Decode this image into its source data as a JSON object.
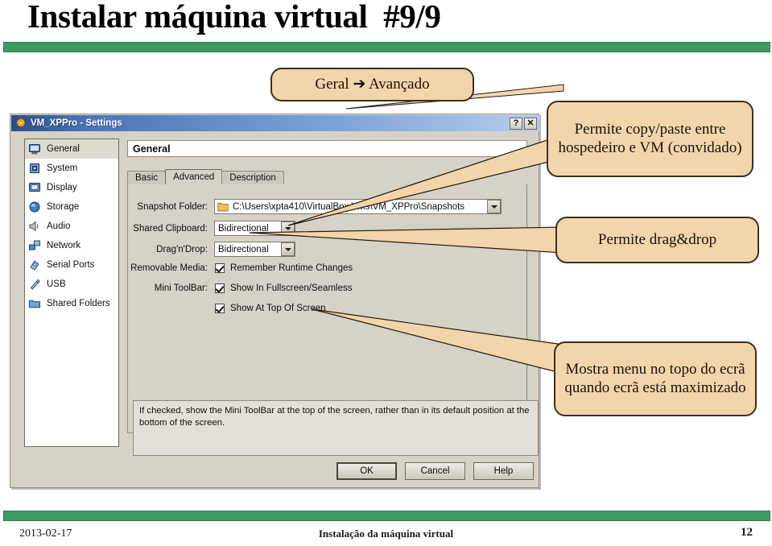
{
  "slide": {
    "title": "Instalar máquina virtual  #9/9",
    "accent_color": "#3d9c63",
    "callout_fill": "#f3d5ab"
  },
  "footer": {
    "date": "2013-02-17",
    "center": "Instalação da máquina virtual",
    "page": "12"
  },
  "callouts": {
    "path": "Geral ➔ Avançado",
    "clipboard": "Permite copy/paste entre hospedeiro e VM (convidado)",
    "dragdrop": "Permite drag&drop",
    "minitoolbar": "Mostra menu no topo do ecrã quando ecrã está maximizado"
  },
  "dialog": {
    "title": "VM_XPPro - Settings",
    "title_icon": "gear-icon",
    "help_button": "?",
    "close_button": "✕",
    "sidebar": [
      {
        "label": "General",
        "icon": "monitor-icon",
        "selected": true
      },
      {
        "label": "System",
        "icon": "chip-icon",
        "selected": false
      },
      {
        "label": "Display",
        "icon": "display-icon",
        "selected": false
      },
      {
        "label": "Storage",
        "icon": "disk-icon",
        "selected": false
      },
      {
        "label": "Audio",
        "icon": "speaker-icon",
        "selected": false
      },
      {
        "label": "Network",
        "icon": "network-icon",
        "selected": false
      },
      {
        "label": "Serial Ports",
        "icon": "serial-port-icon",
        "selected": false
      },
      {
        "label": "USB",
        "icon": "usb-icon",
        "selected": false
      },
      {
        "label": "Shared Folders",
        "icon": "folder-icon",
        "selected": false
      }
    ],
    "pane_title": "General",
    "tabs": [
      {
        "label": "Basic",
        "active": false
      },
      {
        "label": "Advanced",
        "active": true
      },
      {
        "label": "Description",
        "active": false
      }
    ],
    "fields": {
      "snapshot_folder_label": "Snapshot Folder:",
      "snapshot_folder_value": "C:\\Users\\xpta410\\VirtualBox VMs\\VM_XPPro\\Snapshots",
      "shared_clipboard_label": "Shared Clipboard:",
      "shared_clipboard_value": "Bidirectional",
      "dragndrop_label": "Drag'n'Drop:",
      "dragndrop_value": "Bidirectional",
      "removable_media_label": "Removable Media:",
      "removable_media_check": "Remember Runtime Changes",
      "mini_toolbar_label": "Mini ToolBar:",
      "mini_toolbar_check_1": "Show In Fullscreen/Seamless",
      "mini_toolbar_check_2": "Show At Top Of Screen"
    },
    "help_text": "If checked, show the Mini ToolBar at the top of the screen, rather than in its default position at the bottom of the screen.",
    "buttons": {
      "ok": "OK",
      "cancel": "Cancel",
      "help": "Help"
    }
  }
}
